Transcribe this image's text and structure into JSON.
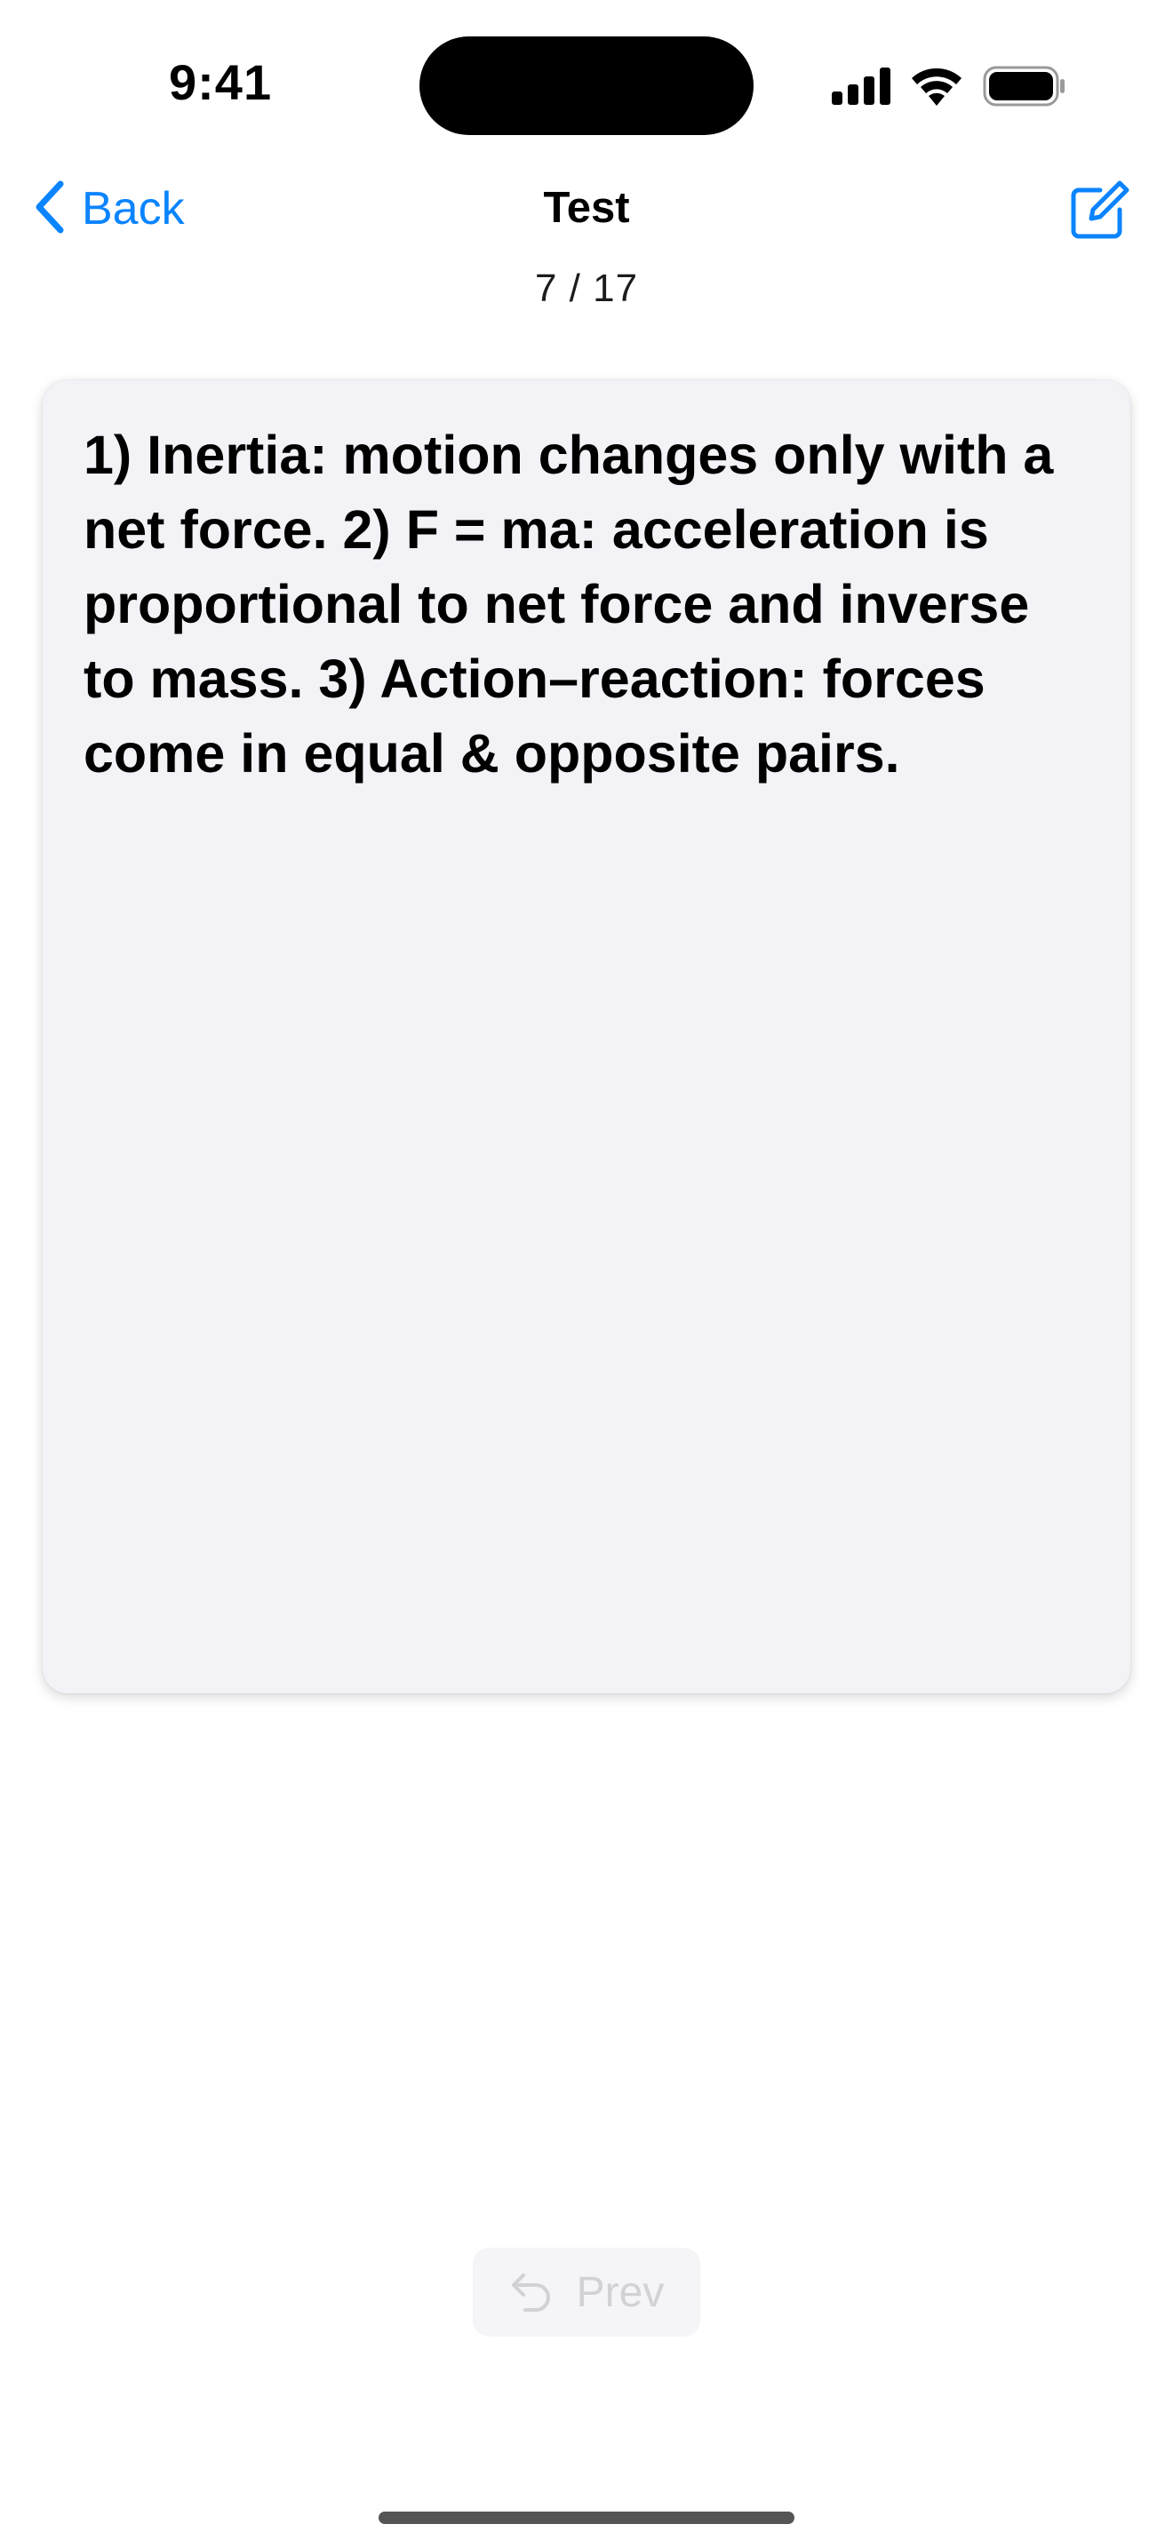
{
  "status_bar": {
    "time": "9:41",
    "icons": [
      "cellular-signal-icon",
      "wifi-icon",
      "battery-icon"
    ]
  },
  "nav": {
    "back_label": "Back",
    "title": "Test",
    "progress": "7 / 17",
    "edit_icon": "compose-icon"
  },
  "card": {
    "text": "1) Inertia: motion changes only with a net force. 2) F = ma: acceleration is proportional to net force and inverse to mass. 3) Action–reaction: forces come in equal & opposite pairs."
  },
  "footer": {
    "prev_label": "Prev",
    "prev_icon": "undo-arrow-icon"
  },
  "colors": {
    "accent": "#0a84ff",
    "card_background": "#f2f2f7",
    "disabled_text": "#d1d1d6"
  }
}
